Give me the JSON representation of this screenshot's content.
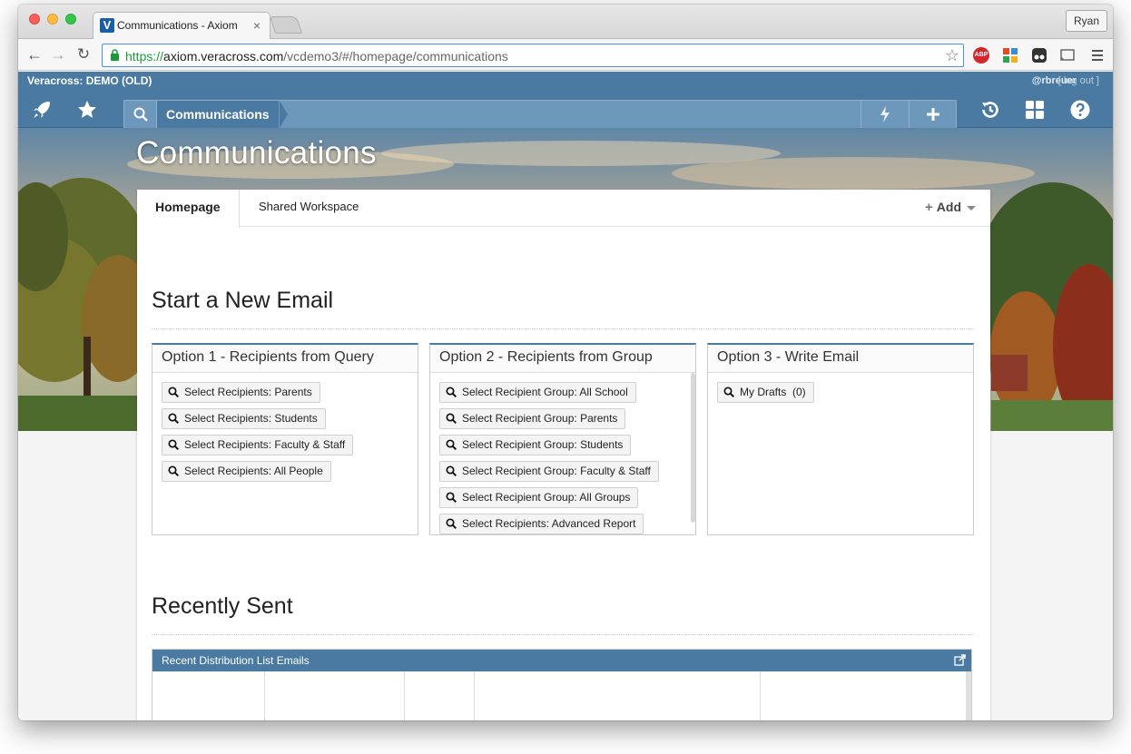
{
  "browser": {
    "tab_title": "Communications - Axiom",
    "tab_favicon_letter": "V",
    "profile_name": "Ryan",
    "url_scheme": "https://",
    "url_host": "axiom.veracross.com",
    "url_path": "/vcdemo3/#/homepage/communications",
    "abp_label": "ABP"
  },
  "app": {
    "brand": "Veracross: DEMO (OLD)",
    "user": "@rbreuer",
    "logout": "[ log out ]",
    "breadcrumb": "Communications"
  },
  "page": {
    "title": "Communications",
    "tabs": [
      {
        "label": "Homepage",
        "active": true
      },
      {
        "label": "Shared Workspace",
        "active": false
      }
    ],
    "add_label": "Add"
  },
  "start_section": {
    "heading": "Start a New Email",
    "options": [
      {
        "title": "Option 1 - Recipients from Query",
        "buttons": [
          "Select Recipients: Parents",
          "Select Recipients: Students",
          "Select Recipients: Faculty & Staff",
          "Select Recipients: All People"
        ]
      },
      {
        "title": "Option 2 - Recipients from Group",
        "buttons": [
          "Select Recipient Group: All School",
          "Select Recipient Group: Parents",
          "Select Recipient Group: Students",
          "Select Recipient Group: Faculty & Staff",
          "Select Recipient Group: All Groups",
          "Select Recipients: Advanced Report"
        ]
      },
      {
        "title": "Option 3 - Write Email",
        "buttons": [
          "My Drafts  (0)"
        ]
      }
    ]
  },
  "recent_section": {
    "heading": "Recently Sent",
    "panel_title": "Recent Distribution List Emails"
  },
  "colors": {
    "brand_blue": "#4a7aa1",
    "nav_panel": "#6e98bb",
    "url_scheme_green": "#1a9a3a"
  }
}
